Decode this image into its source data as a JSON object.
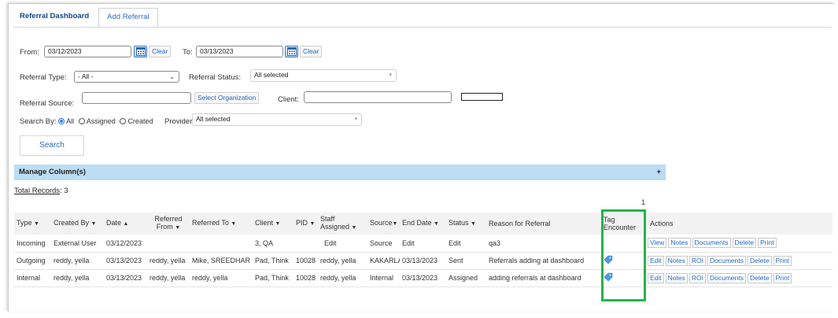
{
  "tabs": {
    "dashboard": "Referral Dashboard",
    "add": "Add Referral"
  },
  "filters": {
    "from_label": "From:",
    "from_value": "03/12/2023",
    "clear1": "Clear",
    "to_label": "To:",
    "to_value": "03/13/2023",
    "clear2": "Clear",
    "type_label": "Referral Type:",
    "type_value": "- All -",
    "status_label": "Referral Status:",
    "status_value": "All selected",
    "source_label": "Referral Source:",
    "source_value": "",
    "select_org": "Select Organization",
    "client_label": "Client:",
    "client_value": "",
    "searchby_label": "Search By:",
    "opt_all": "All",
    "opt_assigned": "Assigned",
    "opt_created": "Created",
    "provider_label": "Provider:",
    "provider_value": "All selected",
    "search_button": "Search"
  },
  "manage_columns": {
    "label": "Manage Column(s)",
    "toggle": "+"
  },
  "total": {
    "prefix": "Total Records",
    "count": ": 3"
  },
  "page_number": "1",
  "columns": {
    "type": "Type",
    "created_by": "Created By",
    "date": "Date",
    "referred_from": "Referred From",
    "referred_to": "Referred To",
    "client": "Client",
    "pid": "PID",
    "staff": "Staff Assigned",
    "source": "Source",
    "end_date": "End Date",
    "status": "Status",
    "reason": "Reason for Referral",
    "tag": "Tag Encounter",
    "actions": "Actions"
  },
  "rows": [
    {
      "type": "Incoming",
      "created_by": "External User",
      "date": "03/12/2023",
      "referred_from": "",
      "referred_to": "",
      "client": "3, QA",
      "pid": "",
      "staff": "Edit",
      "source": "Source",
      "end_date": "Edit",
      "status": "Edit",
      "reason": "qa3",
      "actions": [
        "View",
        "Notes",
        "Documents",
        "Delete",
        "Print"
      ]
    },
    {
      "type": "Outgoing",
      "created_by": "reddy, yella",
      "date": "03/13/2023",
      "referred_from": "reddy, yella",
      "referred_to": "Mike, SREEDHAR",
      "client": "Pad, Think",
      "pid": "10028",
      "staff": "reddy, yella",
      "source": "KAKARLA",
      "end_date": "03/13/2023",
      "status": "Sent",
      "reason": "Referrals adding at dashboard",
      "actions": [
        "Edit",
        "Notes",
        "ROI",
        "Documents",
        "Delete",
        "Print"
      ]
    },
    {
      "type": "Internal",
      "created_by": "reddy, yella",
      "date": "03/13/2023",
      "referred_from": "reddy, yella",
      "referred_to": "reddy, yella",
      "client": "Pad, Think",
      "pid": "10028",
      "staff": "reddy, yella",
      "source": "Internal",
      "end_date": "03/13/2023",
      "status": "Assigned",
      "reason": "adding referrals at dashboard",
      "actions": [
        "Edit",
        "Notes",
        "ROI",
        "Documents",
        "Delete",
        "Print"
      ]
    }
  ],
  "colors": {
    "accent": "#1f68c0",
    "header_bar": "#bcdcf3",
    "highlight": "#27b34a"
  },
  "icons": {
    "date_picker": "calendar-icon",
    "tag": "tag-icon"
  }
}
